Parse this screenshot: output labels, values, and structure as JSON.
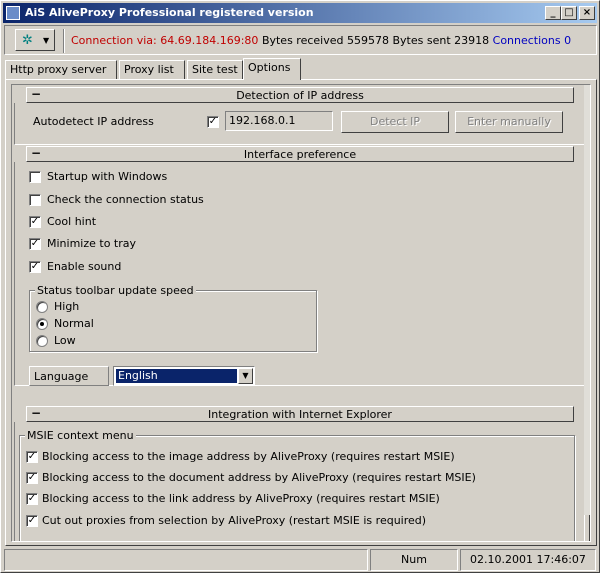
{
  "window": {
    "title": "AiS AliveProxy Professional registered version",
    "buttons": {
      "minimize": "_",
      "maximize": "□",
      "close": "×"
    }
  },
  "toolbar": {
    "menu_icon": "network-icon",
    "connection_label": "Connection via:",
    "connection_address": "64.69.184.169:80",
    "bytes_received_label": "Bytes received",
    "bytes_received": "559578",
    "bytes_sent_label": "Bytes sent",
    "bytes_sent": "23918",
    "connections_label": "Connections",
    "connections": "0",
    "colors": {
      "connection": "#c00000",
      "connections": "#0000c0"
    }
  },
  "tabs": [
    {
      "label": "Http proxy server"
    },
    {
      "label": "Proxy list"
    },
    {
      "label": "Site test"
    },
    {
      "label": "Options",
      "active": true
    }
  ],
  "detection": {
    "header": "Detection of IP address",
    "collapse_glyph": "−",
    "autodetect_label": "Autodetect IP address",
    "autodetect_checked": true,
    "ip_value": "192.168.0.1",
    "detect_button": "Detect IP",
    "enter_button": "Enter manually"
  },
  "interface": {
    "header": "Interface preference",
    "collapse_glyph": "−",
    "options": [
      {
        "label": "Startup with Windows",
        "checked": false
      },
      {
        "label": "Check the connection status",
        "checked": false
      },
      {
        "label": "Cool hint",
        "checked": true
      },
      {
        "label": "Minimize to tray",
        "checked": true
      },
      {
        "label": "Enable sound",
        "checked": true
      }
    ],
    "speed_group": {
      "title": "Status toolbar update speed",
      "options": [
        {
          "label": "High",
          "selected": false
        },
        {
          "label": "Normal",
          "selected": true
        },
        {
          "label": "Low",
          "selected": false
        }
      ]
    },
    "language_label": "Language",
    "language_value": "English"
  },
  "integration": {
    "header": "Integration with Internet Explorer",
    "collapse_glyph": "−",
    "group_title": "MSIE context menu",
    "options": [
      {
        "label": "Blocking access to the image address by AliveProxy (requires restart MSIE)",
        "checked": true
      },
      {
        "label": "Blocking access to the document address by AliveProxy (requires restart MSIE)",
        "checked": true
      },
      {
        "label": "Blocking access to the link address by AliveProxy (requires restart MSIE)",
        "checked": true
      },
      {
        "label": "Cut out proxies from selection by AliveProxy (restart MSIE is required)",
        "checked": true
      }
    ]
  },
  "statusbar": {
    "message": "",
    "num": "Num",
    "datetime": "02.10.2001 17:46:07"
  }
}
